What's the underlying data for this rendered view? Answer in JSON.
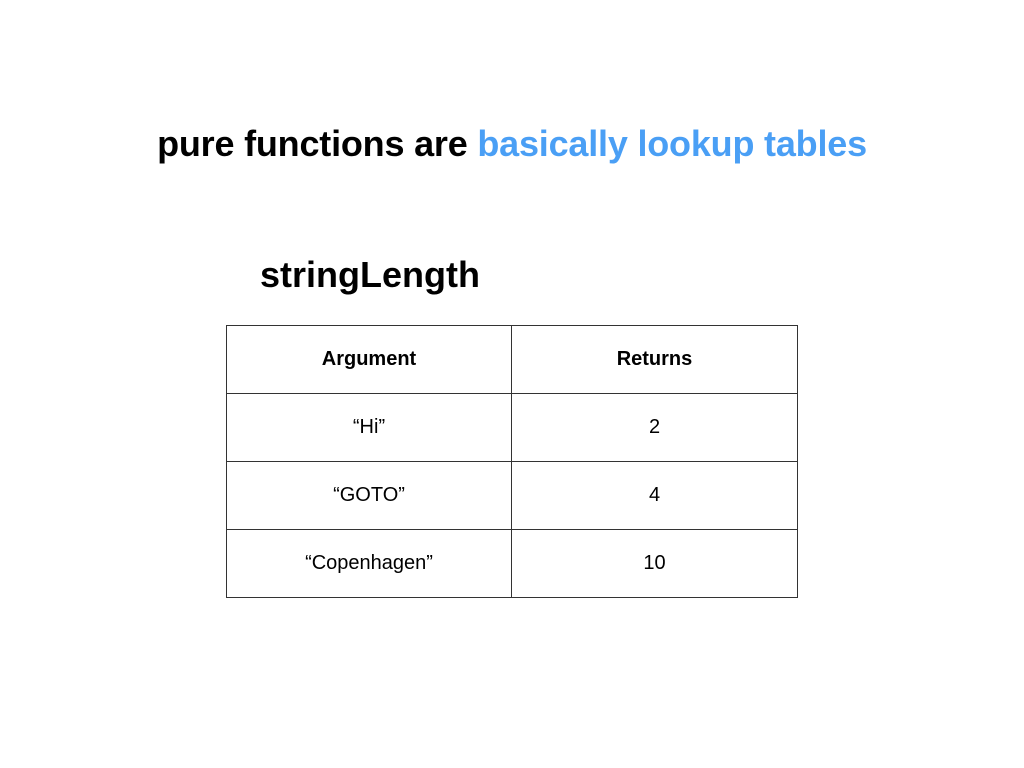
{
  "slide": {
    "title_prefix": "pure functions are ",
    "title_highlight": "basically lookup tables",
    "function_name": "stringLength",
    "accent_color": "#4a9ff5"
  },
  "table": {
    "headers": [
      "Argument",
      "Returns"
    ],
    "rows": [
      [
        "“Hi”",
        "2"
      ],
      [
        "“GOTO”",
        "4"
      ],
      [
        "“Copenhagen”",
        "10"
      ]
    ]
  }
}
